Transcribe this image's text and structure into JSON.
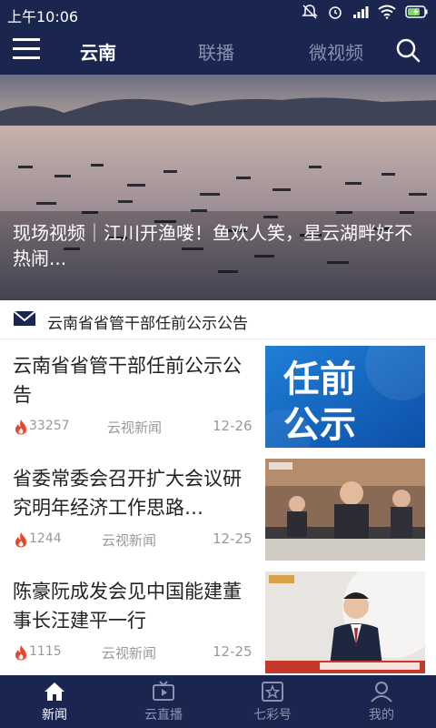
{
  "status_bar": {
    "time": "上午10:06"
  },
  "tabs": [
    {
      "label": "云南"
    },
    {
      "label": "联播"
    },
    {
      "label": "微视频"
    }
  ],
  "hero": {
    "caption": "现场视频｜江川开渔喽！鱼欢人笑，星云湖畔好不热闹..."
  },
  "notice": {
    "text": "云南省省管干部任前公示公告"
  },
  "news": [
    {
      "title": "云南省省管干部任前公示公告",
      "count": "33257",
      "source": "云视新闻",
      "date": "12-26",
      "thumb_text": "任前公示"
    },
    {
      "title": "省委常委会召开扩大会议研究明年经济工作思路…",
      "count": "1244",
      "source": "云视新闻",
      "date": "12-25"
    },
    {
      "title": "陈豪阮成发会见中国能建董事长汪建平一行",
      "count": "1115",
      "source": "云视新闻",
      "date": "12-25"
    }
  ],
  "bottom_nav": [
    {
      "label": "新闻"
    },
    {
      "label": "云直播"
    },
    {
      "label": "七彩号"
    },
    {
      "label": "我的"
    }
  ],
  "colors": {
    "bar": "#1a2650",
    "fire": "#e8452c",
    "muted": "#999999"
  }
}
